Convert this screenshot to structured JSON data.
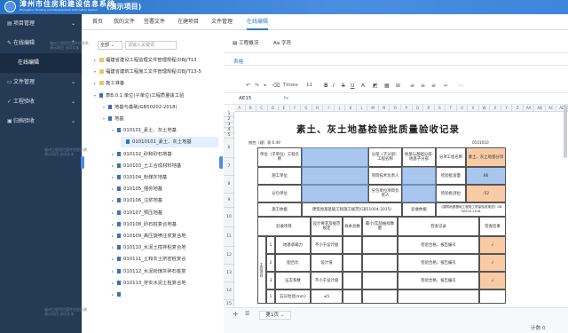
{
  "header": {
    "title": "漳州市住房和建设信息系统",
    "subtitle": "Zhangzhou Housing and Development Information System",
    "project": "(演示项目)"
  },
  "sidebar": {
    "items": [
      {
        "label": "项目管理",
        "icon": "folder-icon"
      },
      {
        "label": "在线编辑",
        "icon": "edit-icon"
      },
      {
        "label": "在线编辑",
        "sub": true
      },
      {
        "label": "文件管理",
        "icon": "file-icon"
      },
      {
        "label": "工程验收",
        "icon": "check-icon"
      },
      {
        "label": "归档验收",
        "icon": "archive-icon"
      }
    ],
    "watermark": [
      "福州工程项目案件信息系统",
      "演示项目 水印文本"
    ]
  },
  "nav": {
    "items": [
      "首页",
      "我的文件",
      "签署文件",
      "在建项目",
      "文件管理",
      "在线编辑"
    ],
    "active": 5
  },
  "tree": {
    "filter": "全部",
    "search_placeholder": "请输入关键词",
    "nodes": [
      {
        "t": "福建省建设工程监理文件管理规程(DBJ/T13",
        "lv": 0,
        "type": "folder",
        "tog": "▸"
      },
      {
        "t": "福建省建筑工程施工文件管理规程(DBJ/T13-5",
        "lv": 0,
        "type": "folder",
        "tog": "▾"
      },
      {
        "t": "施工准备",
        "lv": 1,
        "type": "folder",
        "tog": "▸"
      },
      {
        "t": "表B.0.1 单位(子单位)工程质量竣工验",
        "lv": 1,
        "type": "doc",
        "tog": "▾"
      },
      {
        "t": "地基与基础(GB50202-2018)",
        "lv": 2,
        "type": "doc",
        "tog": "▾"
      },
      {
        "t": "地基",
        "lv": 3,
        "type": "doc",
        "tog": "▾"
      },
      {
        "t": "010101_素土、灰土地基",
        "lv": 4,
        "type": "doc",
        "tog": "▾"
      },
      {
        "t": "01010101_素土、灰土地基",
        "lv": 5,
        "type": "doc",
        "tog": "",
        "sel": true
      },
      {
        "t": "010102_砂和砂石地基",
        "lv": 4,
        "type": "doc",
        "tog": "▸"
      },
      {
        "t": "010103_土工合成材料地基",
        "lv": 4,
        "type": "doc",
        "tog": "▸"
      },
      {
        "t": "010104_粉煤灰地基",
        "lv": 4,
        "type": "doc",
        "tog": "▸"
      },
      {
        "t": "010105_强夯地基",
        "lv": 4,
        "type": "doc",
        "tog": "▸"
      },
      {
        "t": "010106_注浆地基",
        "lv": 4,
        "type": "doc",
        "tog": "▸"
      },
      {
        "t": "010107_预压地基",
        "lv": 4,
        "type": "doc",
        "tog": "▸"
      },
      {
        "t": "010108_砂石桩复合地基",
        "lv": 4,
        "type": "doc",
        "tog": "▸"
      },
      {
        "t": "010109_高压旋喷注浆复合地",
        "lv": 4,
        "type": "doc",
        "tog": "▸"
      },
      {
        "t": "010110_水泥土搅拌桩复合地",
        "lv": 4,
        "type": "doc",
        "tog": "▸"
      },
      {
        "t": "010111_土和灰土挤密桩复合",
        "lv": 4,
        "type": "doc",
        "tog": "▸"
      },
      {
        "t": "010112_水泥粉煤灰碎石桩复",
        "lv": 4,
        "type": "doc",
        "tog": "▸"
      },
      {
        "t": "010113_夯实水泥土桩复合地",
        "lv": 4,
        "type": "doc",
        "tog": "▸"
      },
      {
        "t": "",
        "lv": 4,
        "type": "doc",
        "tog": "▸"
      }
    ]
  },
  "editor": {
    "tabs": [
      "工程概况",
      "Aa 字符"
    ],
    "sheet_tab": "表格",
    "font": "Times",
    "font_size": "11",
    "cell_ref": "AE15",
    "fx": "fx"
  },
  "doc": {
    "title": "素土、灰土地基检验批质量验收记录",
    "code_left": "统控（建）表 0.49",
    "code_right": "0101010",
    "col_letters": [
      "A",
      "B",
      "C",
      "D",
      "E",
      "F",
      "G",
      "H",
      "I",
      "J",
      "K",
      "L",
      "M",
      "N",
      "O",
      "P",
      "Q",
      "R",
      "S",
      "T",
      "U",
      "V",
      "W",
      "X",
      "Y",
      "Z",
      "AA",
      "AB",
      "AC",
      "AD"
    ],
    "rows": [
      "1",
      "2",
      "3",
      "4",
      "5",
      "6",
      "7",
      "8",
      "9",
      "10",
      "11",
      "12",
      "13",
      "14",
      "15",
      "16"
    ],
    "r5": [
      "单位（子单位）工程名称",
      "分部（子分部）工程名称",
      "地基与基础分部-地基子分部",
      "分项工程名称",
      "素土、灰土地基分项"
    ],
    "r6": [
      "施工单位",
      "项目技术负责人",
      "检验批容量",
      "66"
    ],
    "r7": [
      "分包单位",
      "分包单位项目负责人",
      "检验批部位",
      "-52"
    ],
    "r8": [
      "施工依据",
      "建筑地基基础工程施工规范(GB51004-2015)",
      "验收依据",
      "《建筑地基基础工程施工质量验收规范》GB 50202-2018"
    ],
    "r9": [
      "验收项目",
      "设计要求及规范规定",
      "样本总数",
      "最小/实际抽样数量",
      "检查记录",
      "检查结果"
    ],
    "side": "主控项目",
    "items": [
      {
        "no": "1",
        "name": "地基承载力",
        "req": "不小于设计值",
        "rec": "检验合格，报告编号",
        "res": "√"
      },
      {
        "no": "2",
        "name": "配合比",
        "req": "设计值",
        "rec": "检验合格，报告编号",
        "res": "√"
      },
      {
        "no": "3",
        "name": "压实系数",
        "req": "不小于设计值",
        "rec": "检验合格，报告编号",
        "res": "√"
      },
      {
        "no": "1",
        "name": "石灰粒径(mm)",
        "req": "≤5",
        "rec": "",
        "res": ""
      }
    ]
  },
  "bottom": {
    "add": "+",
    "menu": "☰",
    "sheet": "第1页",
    "count": "计数 0"
  }
}
